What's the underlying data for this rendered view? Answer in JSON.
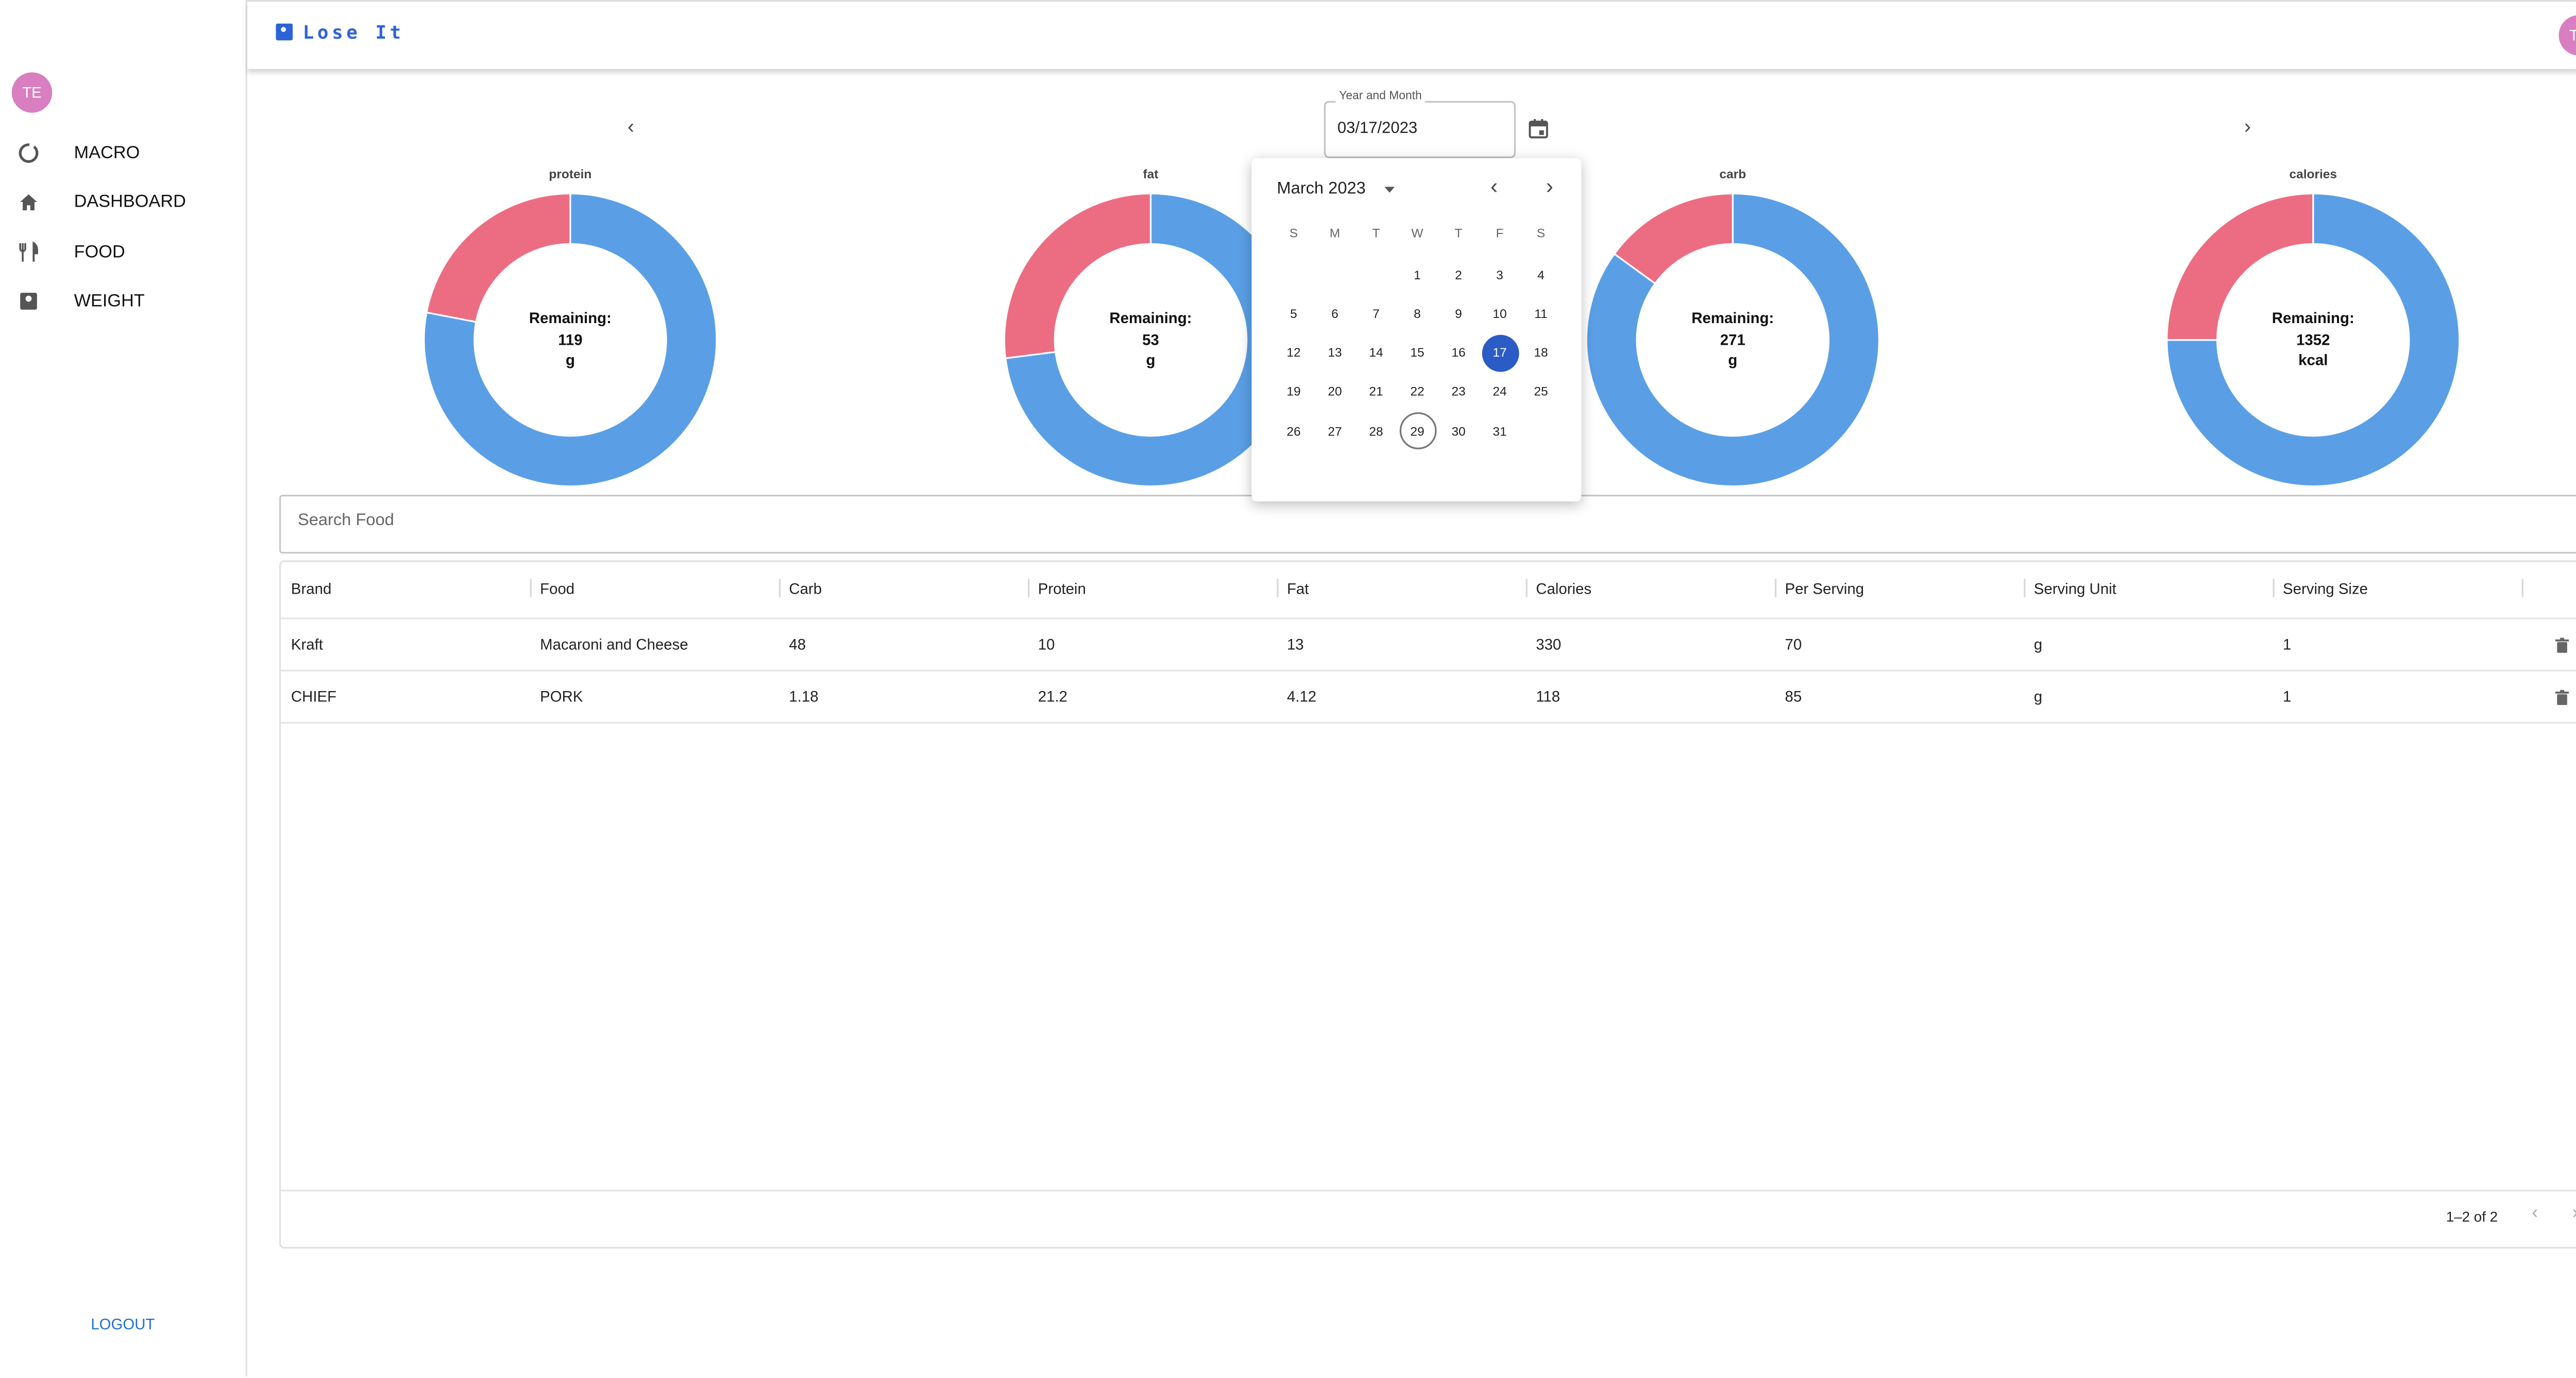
{
  "app": {
    "title": "Lose It",
    "user_initials": "TE"
  },
  "sidebar": {
    "user_initials": "TE",
    "items": [
      {
        "label": "MACRO",
        "icon": "donut-chart-icon"
      },
      {
        "label": "DASHBOARD",
        "icon": "home-icon"
      },
      {
        "label": "FOOD",
        "icon": "fork-knife-icon"
      },
      {
        "label": "WEIGHT",
        "icon": "scale-icon"
      }
    ],
    "logout": "LOGOUT"
  },
  "date_picker": {
    "label": "Year and Month",
    "value": "03/17/2023",
    "month_label": "March 2023",
    "weekdays": [
      "S",
      "M",
      "T",
      "W",
      "T",
      "F",
      "S"
    ],
    "first_weekday_index": 3,
    "days_in_month": 31,
    "selected_day": 17,
    "today_day": 29
  },
  "charts": [
    {
      "title": "protein",
      "center": [
        "Remaining:",
        "119",
        "g"
      ],
      "remaining_fraction": 0.78
    },
    {
      "title": "fat",
      "center": [
        "Remaining:",
        "53",
        "g"
      ],
      "remaining_fraction": 0.73
    },
    {
      "title": "carb",
      "center": [
        "Remaining:",
        "271",
        "g"
      ],
      "remaining_fraction": 0.85
    },
    {
      "title": "calories",
      "center": [
        "Remaining:",
        "1352",
        "kcal"
      ],
      "remaining_fraction": 0.75
    }
  ],
  "chart_colors": {
    "remaining": "#5a9fe6",
    "consumed": "#ec6d82"
  },
  "search": {
    "placeholder": "Search Food"
  },
  "table": {
    "columns": [
      "Brand",
      "Food",
      "Carb",
      "Protein",
      "Fat",
      "Calories",
      "Per Serving",
      "Serving Unit",
      "Serving Size"
    ],
    "rows": [
      [
        "Kraft",
        "Macaroni and Cheese",
        "48",
        "10",
        "13",
        "330",
        "70",
        "g",
        "1"
      ],
      [
        "CHIEF",
        "PORK",
        "1.18",
        "21.2",
        "4.12",
        "118",
        "85",
        "g",
        "1"
      ]
    ],
    "pagination": "1–2 of 2"
  },
  "colors": {
    "accent": "#2d62d8",
    "selected_day": "#2b5bc5",
    "avatar": "#d97ec0"
  }
}
